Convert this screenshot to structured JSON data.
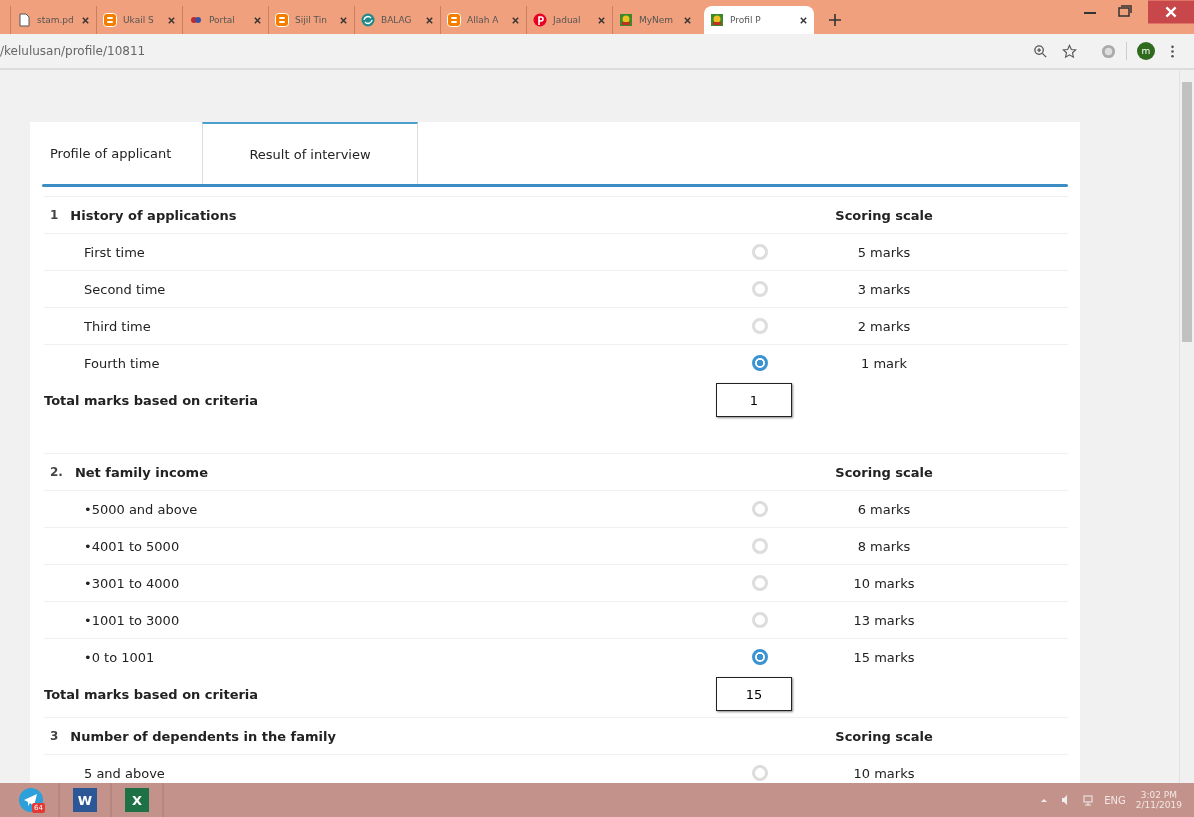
{
  "browser": {
    "tabs": [
      {
        "title": "stam.pd",
        "kind": "doc",
        "selected": false
      },
      {
        "title": "Ukail S",
        "kind": "blogger",
        "selected": false
      },
      {
        "title": "Portal",
        "kind": "portal",
        "selected": false
      },
      {
        "title": "Sijil Tin",
        "kind": "blogger",
        "selected": false
      },
      {
        "title": "BALAG",
        "kind": "globe",
        "selected": false
      },
      {
        "title": "Allah A",
        "kind": "blogger",
        "selected": false
      },
      {
        "title": "Jadual",
        "kind": "pin",
        "selected": false
      },
      {
        "title": "MyNem",
        "kind": "crest",
        "selected": false
      },
      {
        "title": "Profil P",
        "kind": "crest",
        "selected": true
      }
    ],
    "address": "/kelulusan/profile/10811",
    "profile_initial": "m"
  },
  "page_tabs": [
    {
      "label": "Profile of applicant",
      "selected": false
    },
    {
      "label": "Result of interview",
      "selected": true
    }
  ],
  "sections": [
    {
      "number": "1",
      "title": "History of applications",
      "scale_heading": "Scoring scale",
      "options": [
        {
          "label": "First time",
          "selected": false,
          "marks": "5 marks"
        },
        {
          "label": "Second time",
          "selected": false,
          "marks": "3 marks"
        },
        {
          "label": "Third time",
          "selected": false,
          "marks": "2 marks"
        },
        {
          "label": "Fourth time",
          "selected": true,
          "marks": "1 mark"
        }
      ],
      "total_label": "Total marks based on criteria",
      "total_value": "1"
    },
    {
      "number": "2.",
      "title": "Net family income",
      "scale_heading": "Scoring scale",
      "options": [
        {
          "label": "•5000 and above",
          "selected": false,
          "marks": "6 marks"
        },
        {
          "label": "•4001 to 5000",
          "selected": false,
          "marks": "8 marks"
        },
        {
          "label": "•3001 to 4000",
          "selected": false,
          "marks": "10 marks"
        },
        {
          "label": "•1001 to 3000",
          "selected": false,
          "marks": "13 marks"
        },
        {
          "label": "•0 to 1001",
          "selected": true,
          "marks": "15 marks"
        }
      ],
      "total_label": "Total marks based on criteria",
      "total_value": "15"
    },
    {
      "number": "3",
      "title": "Number of dependents in the family",
      "scale_heading": "Scoring scale",
      "options": [
        {
          "label": "5 and above",
          "selected": false,
          "marks": "10 marks"
        }
      ]
    }
  ],
  "taskbar": {
    "apps": [
      {
        "kind": "telegram",
        "badge": "64"
      },
      {
        "kind": "word",
        "letter": "W"
      },
      {
        "kind": "excel",
        "letter": "X"
      }
    ],
    "language": "ENG",
    "time": "3:02 PM",
    "date": "2/11/2019"
  }
}
